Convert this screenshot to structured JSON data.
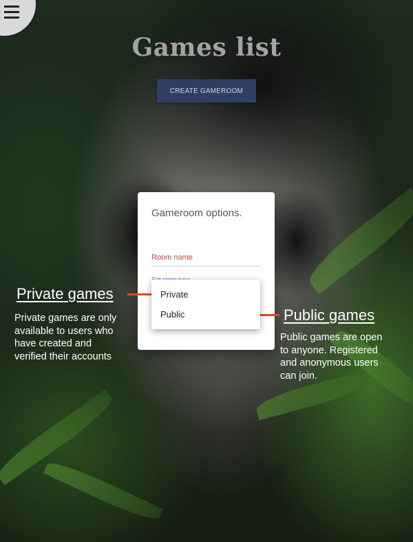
{
  "header": {
    "menu_icon": "hamburger-menu-icon",
    "title": "Games list",
    "create_button_label": "CREATE GAMEROOM"
  },
  "modal": {
    "title": "Gameroom options.",
    "room_name_label": "Room name",
    "room_type_label": "Set room type",
    "dropdown_options": [
      "Private",
      "Public"
    ]
  },
  "annotations": {
    "private": {
      "heading": "Private games",
      "lines": [
        "Private games are only",
        "available to users who",
        "have created and",
        "verified their accounts"
      ]
    },
    "public": {
      "heading": "Public games",
      "lines": [
        "Public games are open",
        "to anyone. Registered",
        "and anonymous users",
        "can join."
      ]
    }
  },
  "colors": {
    "button_bg": "#2f3f63",
    "error_label": "#e53935",
    "pointer": "#e8441d"
  }
}
